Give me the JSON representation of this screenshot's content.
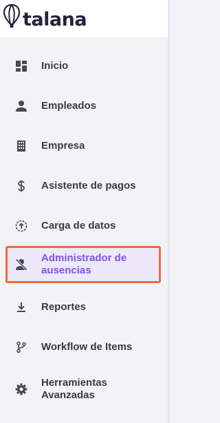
{
  "brand": {
    "name": "talana",
    "logo_icon": "balloon-icon"
  },
  "accent_color": "#7b57e0",
  "highlight_color": "#f06a3b",
  "menu": [
    {
      "label": "Inicio",
      "icon": "dashboard-icon",
      "active": false
    },
    {
      "label": "Empleados",
      "icon": "person-icon",
      "active": false
    },
    {
      "label": "Empresa",
      "icon": "building-icon",
      "active": false
    },
    {
      "label": "Asistente de pagos",
      "icon": "dollar-icon",
      "active": false
    },
    {
      "label": "Carga de datos",
      "icon": "upload-circle-icon",
      "active": false
    },
    {
      "label": "Administrador de ausencias",
      "icon": "person-off-icon",
      "active": true
    },
    {
      "label": "Reportes",
      "icon": "download-icon",
      "active": false
    },
    {
      "label": "Workflow de Items",
      "icon": "branch-icon",
      "active": false
    },
    {
      "label": "Herramientas Avanzadas",
      "icon": "gear-icon",
      "active": false
    }
  ]
}
